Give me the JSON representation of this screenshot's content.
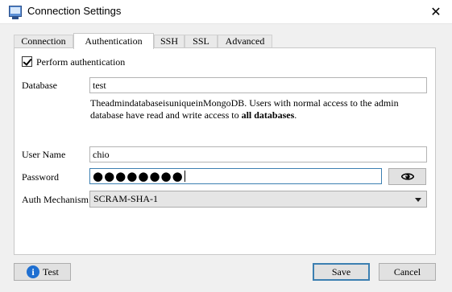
{
  "window": {
    "title": "Connection Settings",
    "close_glyph": "✕"
  },
  "tabs": [
    {
      "label": "Connection",
      "active": false
    },
    {
      "label": "Authentication",
      "active": true
    },
    {
      "label": "SSH",
      "active": false
    },
    {
      "label": "SSL",
      "active": false
    },
    {
      "label": "Advanced",
      "active": false
    }
  ],
  "auth": {
    "perform_label": "Perform authentication",
    "perform_checked": true,
    "database_label": "Database",
    "database_value": "test",
    "note_text": "TheadmindatabaseisuniqueinMongoDB. Users with normal access to the admin database have read and write access to ",
    "note_bold": "all databases",
    "note_end": ".",
    "username_label": "User Name",
    "username_value": "chio",
    "password_label": "Password",
    "password_mask": "●●●●●●●●",
    "mechanism_label": "Auth Mechanism",
    "mechanism_value": "SCRAM-SHA-1"
  },
  "footer": {
    "test_label": "Test",
    "save_label": "Save",
    "cancel_label": "Cancel"
  },
  "icons": {
    "app": "connection-settings-app-icon",
    "info": "info-icon",
    "eye": "eye-icon",
    "dropdown": "chevron-down-icon"
  },
  "colors": {
    "focus_border": "#3c7fb1",
    "info_blue": "#1f6fd1"
  }
}
